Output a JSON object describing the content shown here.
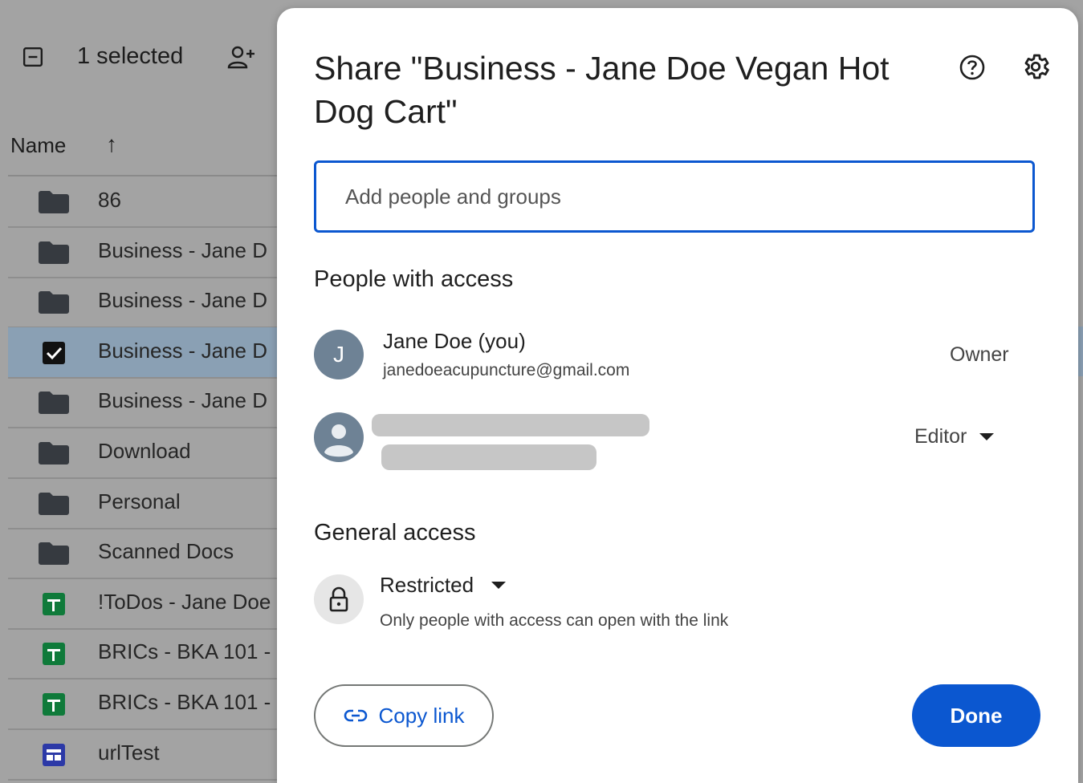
{
  "background": {
    "selection_label": "1 selected",
    "column_name": "Name",
    "sort_arrow": "↑",
    "rows": [
      {
        "name": "86",
        "icon": "folder-icon"
      },
      {
        "name": "Business - Jane D",
        "icon": "folder-icon"
      },
      {
        "name": "Business - Jane D",
        "icon": "folder-icon"
      },
      {
        "name": "Business - Jane D",
        "icon": "checkbox-checked-icon",
        "selected": true
      },
      {
        "name": "Business - Jane D",
        "icon": "folder-icon"
      },
      {
        "name": "Download",
        "icon": "folder-icon"
      },
      {
        "name": "Personal",
        "icon": "folder-icon"
      },
      {
        "name": "Scanned Docs",
        "icon": "folder-icon"
      },
      {
        "name": "!ToDos - Jane Doe",
        "icon": "sheets-icon"
      },
      {
        "name": "BRICs - BKA 101 -",
        "icon": "sheets-icon"
      },
      {
        "name": "BRICs - BKA 101 -",
        "icon": "sheets-icon"
      },
      {
        "name": "urlTest",
        "icon": "forms-icon"
      }
    ]
  },
  "dialog": {
    "title": "Share \"Business - Jane Doe Vegan Hot Dog Cart\"",
    "input_placeholder": "Add people and groups",
    "people_heading": "People with access",
    "people": [
      {
        "initial": "J",
        "name": "Jane Doe (you)",
        "email": "janedoeacupuncture@gmail.com",
        "role": "Owner"
      },
      {
        "role": "Editor"
      }
    ],
    "general_heading": "General access",
    "access_level": "Restricted",
    "access_description": "Only people with access can open with the link",
    "copy_link_label": "Copy link",
    "done_label": "Done"
  },
  "colors": {
    "accent": "#0b57d0",
    "selected_row": "#8aa0b4",
    "avatar": "#6e8295",
    "sheets_green": "#0f7a3a",
    "forms_blue": "#2c39a7"
  }
}
